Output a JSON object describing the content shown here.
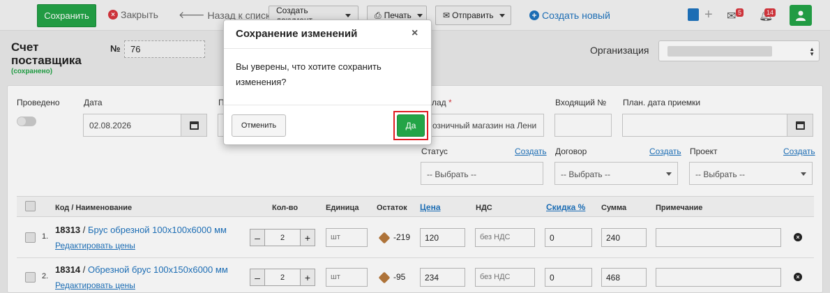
{
  "toolbar": {
    "save": "Сохранить",
    "close": "Закрыть",
    "back": "Назад к списку",
    "create_doc": "Создать документ",
    "print": "Печать",
    "send": "Отправить",
    "create_new": "Создать новый",
    "mail_badge": "5",
    "notify_badge": "14"
  },
  "header": {
    "title": "Счет поставщика",
    "subtitle": "(сохранено)",
    "number_label": "№",
    "number_value": "76",
    "org_label": "Организация"
  },
  "form": {
    "posted_label": "Проведено",
    "date_label": "Дата",
    "date_value": "02.08.2026",
    "hidden_label_fragment": "П",
    "warehouse_label_fragment": "лад",
    "warehouse_value_fragment": "озничный магазин на Лени",
    "incoming_label": "Входящий №",
    "receipt_date_label": "План. дата приемки",
    "status_label": "Статус",
    "contract_label": "Договор",
    "project_label": "Проект",
    "create_link": "Создать",
    "select_placeholder": "-- Выбрать --"
  },
  "table": {
    "headers": {
      "code_name": "Код / Наименование",
      "qty": "Кол-во",
      "unit": "Единица",
      "stock": "Остаток",
      "price": "Цена",
      "vat": "НДС",
      "discount": "Скидка %",
      "sum": "Сумма",
      "note": "Примечание"
    },
    "edit_prices": "Редактировать цены",
    "rows": [
      {
        "num": "1.",
        "code": "18313",
        "sep": " / ",
        "name": "Брус обрезной 100х100х6000 мм",
        "qty": "2",
        "unit": "шт",
        "stock": "-219",
        "price": "120",
        "vat": "без НДС",
        "discount": "0",
        "sum": "240",
        "note": ""
      },
      {
        "num": "2.",
        "code": "18314",
        "sep": " / ",
        "name": "Обрезной брус 100х150х6000 мм",
        "qty": "2",
        "unit": "шт",
        "stock": "-95",
        "price": "234",
        "vat": "без НДС",
        "discount": "0",
        "sum": "468",
        "note": ""
      }
    ]
  },
  "modal": {
    "title": "Сохранение изменений",
    "close": "×",
    "body": "Вы уверены, что хотите сохранить изменения?",
    "cancel": "Отменить",
    "confirm": "Да"
  },
  "colors": {
    "primary_green": "#23a447",
    "link_blue": "#1e73be",
    "danger_red": "#d9363e",
    "highlight_red": "#e01b22"
  }
}
